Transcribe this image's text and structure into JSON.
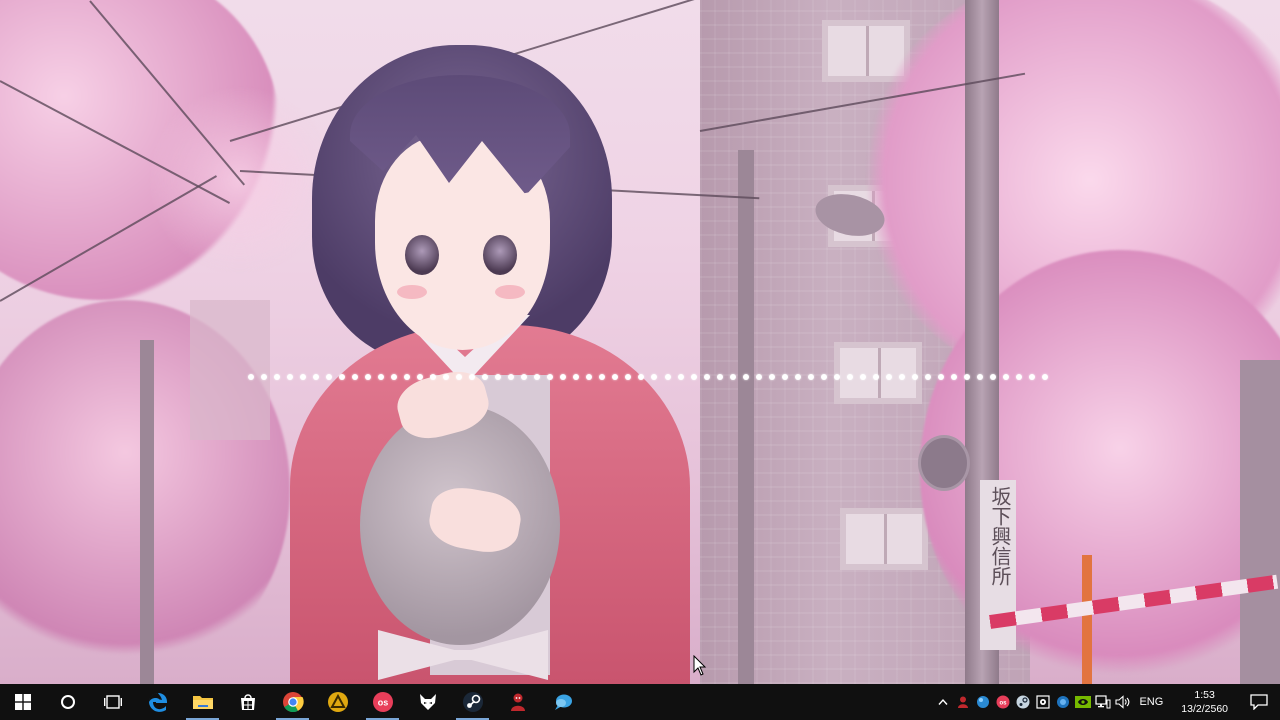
{
  "wallpaper": {
    "sign_text": "坂下興信所",
    "visualizer_dot_count": 62
  },
  "taskbar": {
    "pinned_apps": [
      {
        "name": "Cortana search",
        "icon": "cortana-circle-icon"
      },
      {
        "name": "Task View",
        "icon": "task-view-icon"
      },
      {
        "name": "Microsoft Edge",
        "icon": "edge-icon"
      },
      {
        "name": "File Explorer",
        "icon": "folder-icon"
      },
      {
        "name": "Store",
        "icon": "store-icon"
      },
      {
        "name": "Google Chrome",
        "icon": "chrome-icon"
      },
      {
        "name": "Warning app",
        "icon": "warning-triangle-icon"
      },
      {
        "name": "osu!",
        "icon": "osu-icon"
      },
      {
        "name": "Fox app",
        "icon": "fox-icon"
      },
      {
        "name": "Steam",
        "icon": "steam-icon"
      },
      {
        "name": "Game app",
        "icon": "red-character-icon"
      },
      {
        "name": "Chat app",
        "icon": "chat-bubble-icon"
      }
    ],
    "tray": {
      "language": "ENG",
      "time": "1:53",
      "date": "13/2/2560"
    },
    "colors": {
      "background": "#101010",
      "active_indicator": "#7aa6d6"
    }
  }
}
